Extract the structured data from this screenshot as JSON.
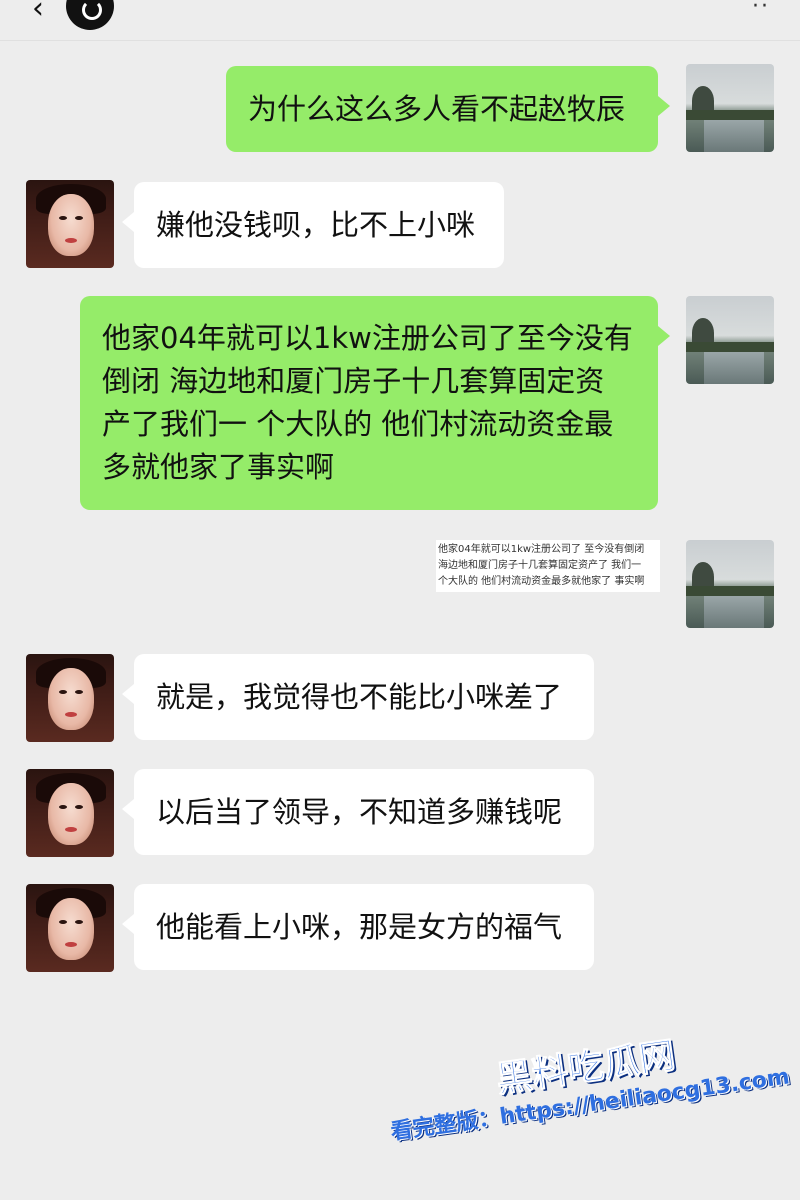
{
  "header": {
    "back_icon": "back-arrow-icon",
    "more_icon": "more-icon"
  },
  "messages": [
    {
      "side": "right",
      "text": "为什么这么多人看不起赵牧辰"
    },
    {
      "side": "left",
      "text": "嫌他没钱呗，比不上小咪"
    },
    {
      "side": "right",
      "lines": [
        "他家04年就可以1kw注册公司了至今没有",
        "倒闭 海边地和厦门房子十几套算固定资",
        "产了我们一 个大队的 他们村流动资金最",
        "多就他家了事实啊"
      ]
    },
    {
      "side": "right",
      "type": "image",
      "lines": [
        "他家04年就可以1kw注册公司了 至今没有倒闭",
        "海边地和厦门房子十几套算固定资产了 我们一",
        "个大队的 他们村流动资金最多就他家了 事实啊"
      ]
    },
    {
      "side": "left",
      "text": "就是，我觉得也不能比小咪差了"
    },
    {
      "side": "left",
      "text": "以后当了领导，不知道多赚钱呢"
    },
    {
      "side": "left",
      "text": "他能看上小咪，那是女方的福气"
    }
  ],
  "watermark": {
    "brand": "黑料吃瓜网",
    "url_line": "看完整版：https://heiliaocg13.com"
  },
  "colors": {
    "background": "#ededed",
    "sent_bubble": "#95ec69",
    "received_bubble": "#ffffff",
    "watermark_blue": "#2f6fe0"
  }
}
